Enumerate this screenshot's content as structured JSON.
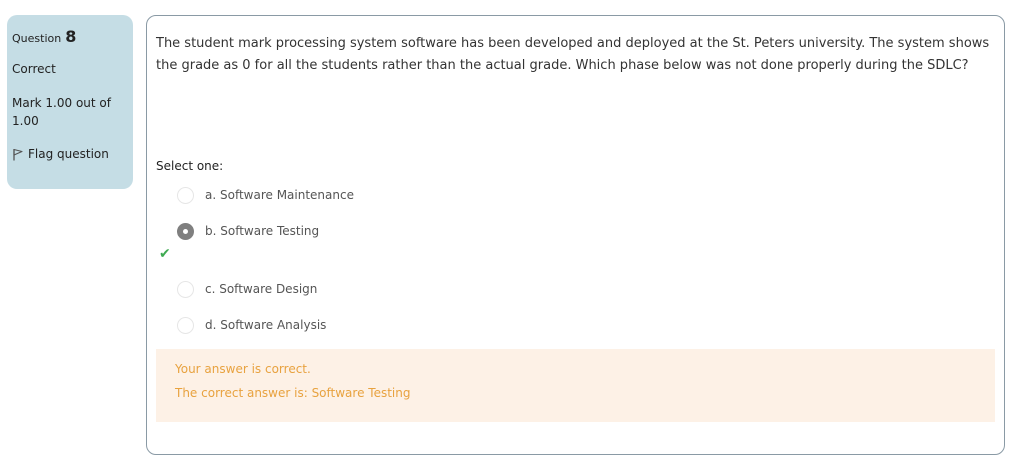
{
  "info": {
    "question_label": "Question",
    "question_number": "8",
    "state": "Correct",
    "grade": "Mark 1.00 out of 1.00",
    "flag_label": "Flag question",
    "flag_icon": "flag-icon"
  },
  "question": {
    "text": "The student mark processing system software has been developed and deployed at the St. Peters university. The system shows the grade as 0 for all the students rather than the actual grade. Which phase below was not done properly during the SDLC?",
    "prompt": "Select one:",
    "options": [
      {
        "label": "a. Software Maintenance",
        "selected": false
      },
      {
        "label": "b. Software Testing",
        "selected": true,
        "feedback_icon": "check-icon"
      },
      {
        "label": "c. Software Design",
        "selected": false
      },
      {
        "label": "d. Software Analysis",
        "selected": false
      }
    ]
  },
  "outcome": {
    "feedback": "Your answer is correct.",
    "right_answer": "The correct answer is: Software Testing"
  },
  "colors": {
    "info_background": "#c5dde5",
    "outcome_background": "#fdf1e6",
    "outcome_text": "#e8a23f",
    "correct_tick": "#3faa52"
  }
}
